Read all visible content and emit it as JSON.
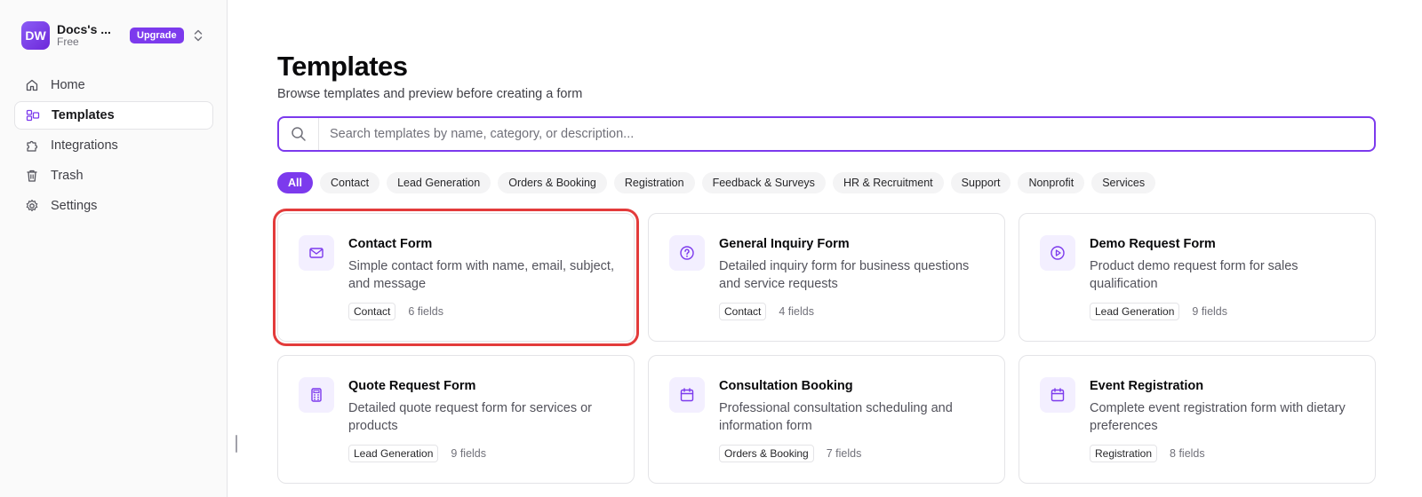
{
  "workspace": {
    "initials": "DW",
    "name": "Docs's ...",
    "plan": "Free",
    "upgrade_label": "Upgrade"
  },
  "nav": [
    {
      "label": "Home",
      "icon": "home-icon",
      "active": false
    },
    {
      "label": "Templates",
      "icon": "templates-icon",
      "active": true
    },
    {
      "label": "Integrations",
      "icon": "puzzle-icon",
      "active": false
    },
    {
      "label": "Trash",
      "icon": "trash-icon",
      "active": false
    },
    {
      "label": "Settings",
      "icon": "gear-icon",
      "active": false
    }
  ],
  "page": {
    "title": "Templates",
    "subtitle": "Browse templates and preview before creating a form",
    "search_placeholder": "Search templates by name, category, or description..."
  },
  "filters": [
    "All",
    "Contact",
    "Lead Generation",
    "Orders & Booking",
    "Registration",
    "Feedback & Surveys",
    "HR & Recruitment",
    "Support",
    "Nonprofit",
    "Services"
  ],
  "active_filter": "All",
  "templates": [
    {
      "title": "Contact Form",
      "description": "Simple contact form with name, email, subject, and message",
      "category": "Contact",
      "fields": "6 fields",
      "icon": "mail-icon",
      "selected": true
    },
    {
      "title": "General Inquiry Form",
      "description": "Detailed inquiry form for business questions and service requests",
      "category": "Contact",
      "fields": "4 fields",
      "icon": "question-icon",
      "selected": false
    },
    {
      "title": "Demo Request Form",
      "description": "Product demo request form for sales qualification",
      "category": "Lead Generation",
      "fields": "9 fields",
      "icon": "play-icon",
      "selected": false
    },
    {
      "title": "Quote Request Form",
      "description": "Detailed quote request form for services or products",
      "category": "Lead Generation",
      "fields": "9 fields",
      "icon": "calculator-icon",
      "selected": false
    },
    {
      "title": "Consultation Booking",
      "description": "Professional consultation scheduling and information form",
      "category": "Orders & Booking",
      "fields": "7 fields",
      "icon": "calendar-icon",
      "selected": false
    },
    {
      "title": "Event Registration",
      "description": "Complete event registration form with dietary preferences",
      "category": "Registration",
      "fields": "8 fields",
      "icon": "calendar-icon",
      "selected": false
    }
  ],
  "colors": {
    "accent": "#7c3aed",
    "selected_outline": "#e33b3b"
  }
}
